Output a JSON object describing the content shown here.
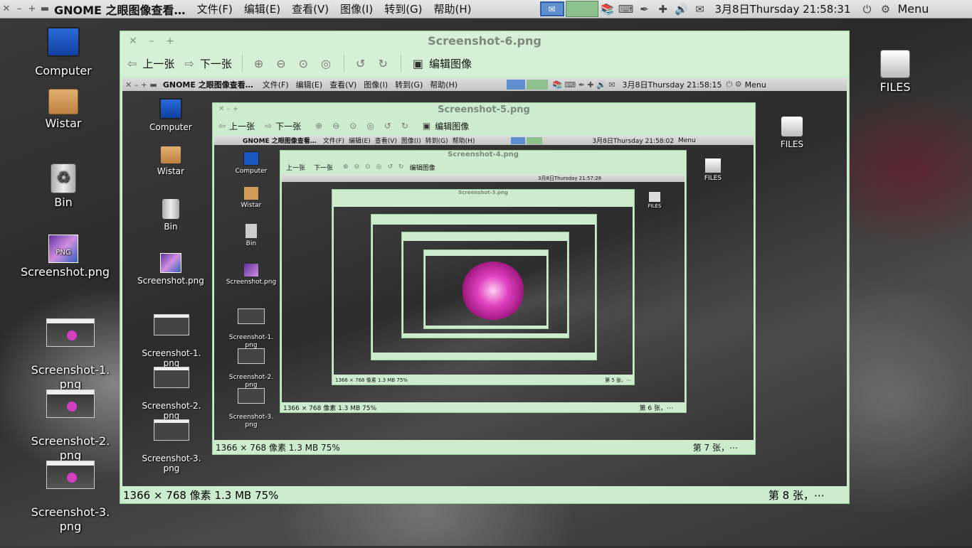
{
  "top_panel": {
    "app_title": "GNOME 之眼图像查看…",
    "menus": [
      "文件(F)",
      "编辑(E)",
      "查看(V)",
      "图像(I)",
      "转到(G)",
      "帮助(H)"
    ],
    "clock": "3月8日Thursday 21:58:31",
    "menu_label": "Menu"
  },
  "desktop": {
    "left_icons": [
      "Computer",
      "Wistar",
      "Bin",
      "Screenshot.png",
      "Screenshot-1.\npng",
      "Screenshot-2.\npng",
      "Screenshot-3.\npng"
    ],
    "right_icon": "FILES"
  },
  "viewer": {
    "title": "Screenshot-6.png",
    "prev_label": "上一张",
    "next_label": "下一张",
    "edit_label": "编辑图像",
    "status_left": "1366 × 768 像素   1.3 MB    75%",
    "status_right": "第 8 张，⋯"
  },
  "nested": {
    "level1": {
      "clock": "3月8日Thursday 21:58:15",
      "title": "Screenshot-5.png",
      "status_left": "1366 × 768 像素   1.3 MB    75%",
      "status_right": "第 7 张，⋯",
      "icons": [
        "Computer",
        "Wistar",
        "Bin",
        "Screenshot.png",
        "Screenshot-1.\npng",
        "Screenshot-2.\npng",
        "Screenshot-3.\npng"
      ],
      "right_icon": "FILES"
    },
    "level2": {
      "clock": "3月8日Thursday 21:58:02",
      "title": "Screenshot-4.png",
      "status_left": "1366 × 768 像素   1.3 MB    75%",
      "status_right": "第 6 张，⋯",
      "icons": [
        "Computer",
        "Wistar",
        "Bin",
        "Screenshot.png",
        "Screenshot-1.\npng",
        "Screenshot-2.\npng",
        "Screenshot-3.\npng"
      ],
      "right_icon": "FILES"
    },
    "level3": {
      "clock": "3月8日Thursday 21:57:28",
      "title": "Screenshot-3.png",
      "status_left": "1366 × 768 像素   1.3 MB    75%",
      "status_right": "第 5 张，⋯",
      "right_icon": "FILES"
    }
  },
  "colors": {
    "window_bg": "#cdeccd",
    "accent": "#5d8fcf",
    "title_text": "#7b8a7b"
  }
}
